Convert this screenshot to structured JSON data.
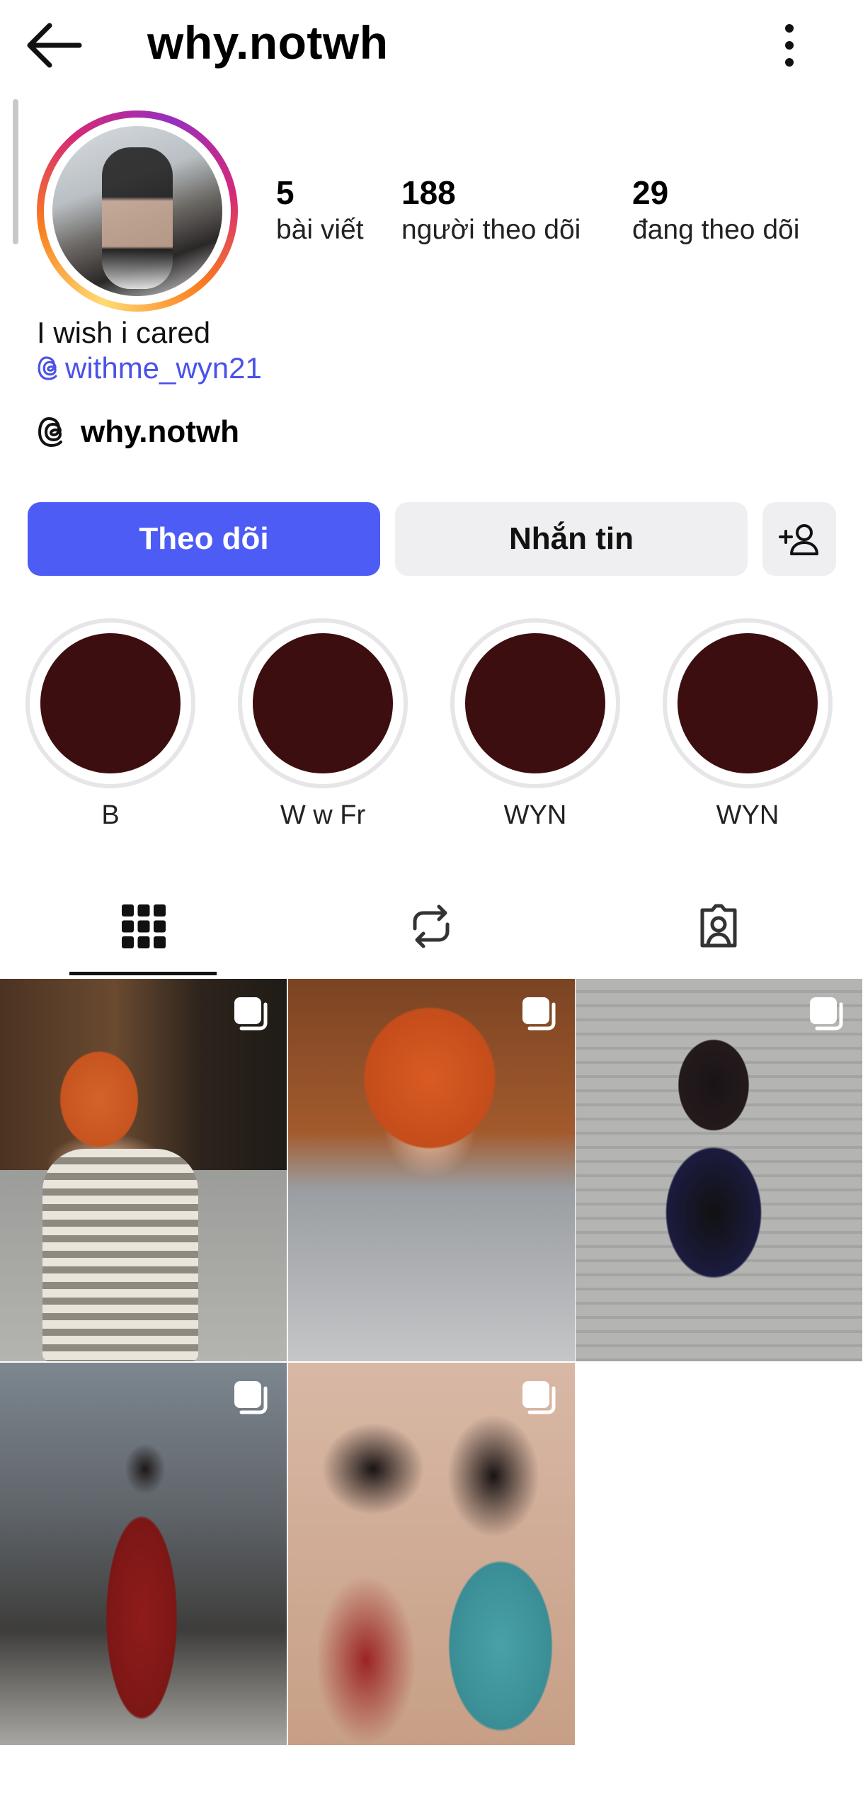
{
  "header": {
    "username": "why.notwh"
  },
  "profile": {
    "stats": {
      "posts_count": "5",
      "posts_label": "bài viết",
      "followers_count": "188",
      "followers_label": "người theo dõi",
      "following_count": "29",
      "following_label": "đang theo dõi"
    },
    "bio": "I wish i cared",
    "bio_link": "withme_wyn21",
    "threads_name": "why.notwh"
  },
  "actions": {
    "follow_label": "Theo dõi",
    "message_label": "Nhắn tin",
    "suggest_icon": "add-user-icon"
  },
  "highlights": [
    {
      "label": "B"
    },
    {
      "label": "W w Fr"
    },
    {
      "label": "WYN"
    },
    {
      "label": "WYN"
    }
  ],
  "tabs": [
    {
      "name": "grid",
      "icon": "grid-icon",
      "active": true
    },
    {
      "name": "reposts",
      "icon": "repost-icon",
      "active": false
    },
    {
      "name": "tagged",
      "icon": "tagged-person-icon",
      "active": false
    }
  ],
  "posts": [
    {
      "type": "carousel"
    },
    {
      "type": "carousel"
    },
    {
      "type": "carousel"
    },
    {
      "type": "carousel"
    },
    {
      "type": "carousel"
    }
  ],
  "colors": {
    "follow_button": "#4d5cf5",
    "link": "#4a52e8",
    "highlight_cover": "#3d0e10",
    "secondary_button": "#efeff1"
  }
}
